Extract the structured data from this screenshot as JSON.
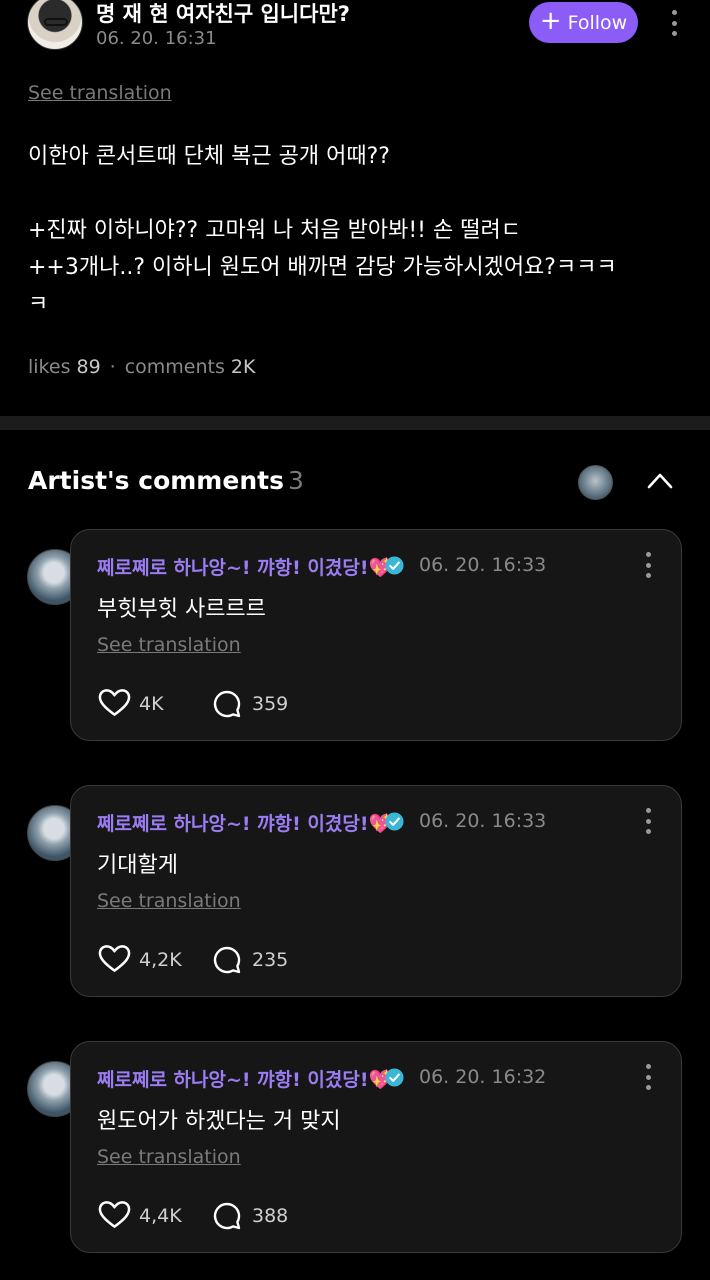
{
  "post": {
    "author_name": "명 재 현 여자친구 입니다만?",
    "time": "06. 20. 16:31",
    "follow_label": "Follow",
    "see_translation": "See translation",
    "body": "이한아 콘서트때 단체 복근 공개 어때??\n\n+진짜 이하니야?? 고마워 나 처음 받아봐!! 손 떨려ㄷ\n++3개나..? 이하니 원도어 배까면 감당 가능하시겠어요?ㅋㅋㅋ\nㅋ",
    "likes_label": "likes",
    "likes_value": "89",
    "separator": "·",
    "comments_label": "comments",
    "comments_value": "2K"
  },
  "artist_comments": {
    "title": "Artist's comments",
    "count": "3",
    "items": [
      {
        "name": "쩨로쩨로 하나앙~! 꺄항! 이겼당!💖",
        "time": "06. 20. 16:33",
        "text": "부힛부힛 사르르르",
        "translate": "See translation",
        "likes": "4K",
        "replies": "359"
      },
      {
        "name": "쩨로쩨로 하나앙~! 꺄항! 이겼당!💖",
        "time": "06. 20. 16:33",
        "text": "기대할게",
        "translate": "See translation",
        "likes": "4,2K",
        "replies": "235"
      },
      {
        "name": "쩨로쩨로 하나앙~! 꺄항! 이겼당!💖",
        "time": "06. 20. 16:32",
        "text": "원도어가 하겠다는 거 맞지",
        "translate": "See translation",
        "likes": "4,4K",
        "replies": "388"
      }
    ]
  },
  "colors": {
    "accent": "#8b5cf6",
    "verified": "#3bb6d6",
    "background": "#000000"
  },
  "icons": [
    "more-icon",
    "plus-icon",
    "chevron-up-icon",
    "verified-badge-icon",
    "heart-icon",
    "comment-bubble-icon"
  ]
}
